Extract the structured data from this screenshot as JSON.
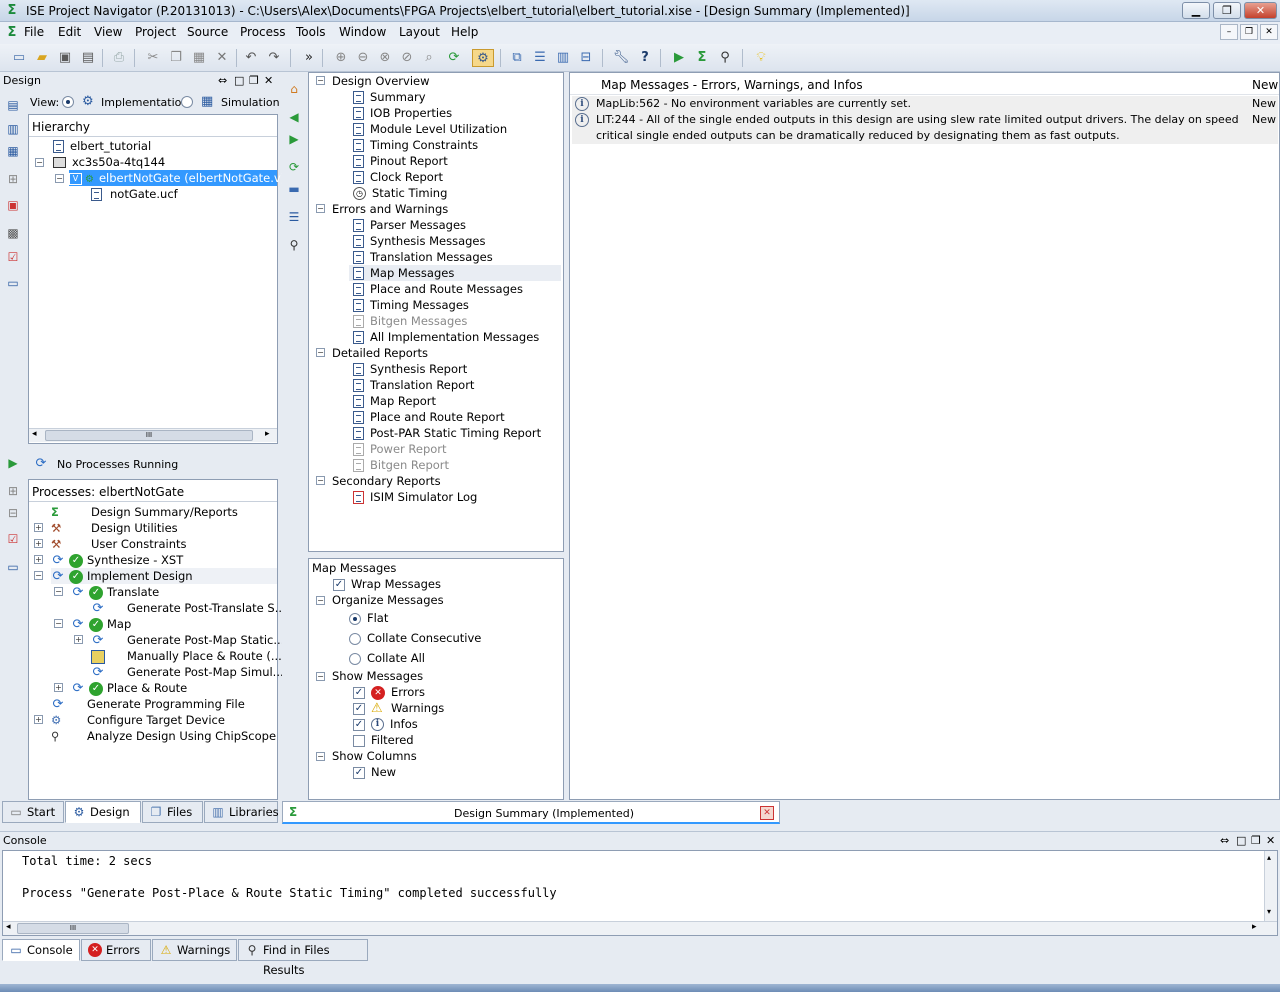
{
  "window": {
    "title": "ISE Project Navigator (P.20131013) - C:\\Users\\Alex\\Documents\\FPGA Projects\\elbert_tutorial\\elbert_tutorial.xise - [Design Summary (Implemented)]",
    "minimize": "▁",
    "restore": "❐",
    "close": "✕"
  },
  "menubar": {
    "items": [
      "File",
      "Edit",
      "View",
      "Project",
      "Source",
      "Process",
      "Tools",
      "Window",
      "Layout",
      "Help"
    ],
    "doc_min": "–",
    "doc_restore": "❐",
    "doc_close": "✕"
  },
  "design_panel": {
    "title": "Design",
    "view_label": "View:",
    "impl_label": "Implementation",
    "sim_label": "Simulation",
    "hierarchy_label": "Hierarchy",
    "tree": [
      {
        "label": "elbert_tutorial"
      },
      {
        "label": "xc3s50a-4tq144"
      },
      {
        "label": "elbertNotGate (elbertNotGate.v)"
      },
      {
        "label": "notGate.ucf"
      }
    ],
    "scroll_label": "III"
  },
  "process_panel": {
    "status": "No Processes Running",
    "header": "Processes: elbertNotGate",
    "items": [
      {
        "label": "Design Summary/Reports"
      },
      {
        "label": "Design Utilities"
      },
      {
        "label": "User Constraints"
      },
      {
        "label": "Synthesize - XST"
      },
      {
        "label": "Implement Design"
      },
      {
        "label": "Translate"
      },
      {
        "label": "Generate Post-Translate S..."
      },
      {
        "label": "Map"
      },
      {
        "label": "Generate Post-Map Static..."
      },
      {
        "label": "Manually Place & Route (..."
      },
      {
        "label": "Generate Post-Map Simul..."
      },
      {
        "label": "Place & Route"
      },
      {
        "label": "Generate Programming File"
      },
      {
        "label": "Configure Target Device"
      },
      {
        "label": "Analyze Design Using ChipScope"
      }
    ]
  },
  "left_tabs": [
    "Start",
    "Design",
    "Files",
    "Libraries"
  ],
  "summary_tree": {
    "sections": [
      {
        "title": "Design Overview",
        "items": [
          {
            "label": "Summary",
            "enabled": true
          },
          {
            "label": "IOB Properties",
            "enabled": true
          },
          {
            "label": "Module Level Utilization",
            "enabled": true
          },
          {
            "label": "Timing Constraints",
            "enabled": true
          },
          {
            "label": "Pinout Report",
            "enabled": true
          },
          {
            "label": "Clock Report",
            "enabled": true
          },
          {
            "label": "Static Timing",
            "enabled": true
          }
        ]
      },
      {
        "title": "Errors and Warnings",
        "items": [
          {
            "label": "Parser Messages",
            "enabled": true
          },
          {
            "label": "Synthesis Messages",
            "enabled": true
          },
          {
            "label": "Translation Messages",
            "enabled": true
          },
          {
            "label": "Map Messages",
            "enabled": true
          },
          {
            "label": "Place and Route Messages",
            "enabled": true
          },
          {
            "label": "Timing Messages",
            "enabled": true
          },
          {
            "label": "Bitgen Messages",
            "enabled": false
          },
          {
            "label": "All Implementation Messages",
            "enabled": true
          }
        ]
      },
      {
        "title": "Detailed Reports",
        "items": [
          {
            "label": "Synthesis Report",
            "enabled": true
          },
          {
            "label": "Translation Report",
            "enabled": true
          },
          {
            "label": "Map Report",
            "enabled": true
          },
          {
            "label": "Place and Route Report",
            "enabled": true
          },
          {
            "label": "Post-PAR Static Timing Report",
            "enabled": true
          },
          {
            "label": "Power Report",
            "enabled": false
          },
          {
            "label": "Bitgen Report",
            "enabled": false
          }
        ]
      },
      {
        "title": "Secondary Reports",
        "items": [
          {
            "label": "ISIM Simulator Log",
            "enabled": true
          }
        ]
      }
    ]
  },
  "options": {
    "title": "Map Messages",
    "wrap": "Wrap Messages",
    "organize": "Organize Messages",
    "flat": "Flat",
    "collate_consecutive": "Collate Consecutive",
    "collate_all": "Collate All",
    "show_messages": "Show Messages",
    "errors": "Errors",
    "warnings": "Warnings",
    "infos": "Infos",
    "filtered": "Filtered",
    "show_columns": "Show Columns",
    "new": "New"
  },
  "messages": {
    "header": "Map Messages - Errors, Warnings, and Infos",
    "new_col": "New",
    "rows": [
      {
        "text": "MapLib:562 - No environment variables are currently set.",
        "new": "New"
      },
      {
        "text": "LIT:244 - All of the single ended outputs in this design are using slew rate limited output drivers. The delay on speed critical single ended outputs can be dramatically reduced by designating them as fast outputs.",
        "new": "New"
      }
    ]
  },
  "doc_tab": {
    "label": "Design Summary (Implemented)"
  },
  "console": {
    "title": "Console",
    "lines": [
      "Total time: 2 secs",
      "",
      "Process \"Generate Post-Place & Route Static Timing\" completed successfully"
    ],
    "scroll_label": "III"
  },
  "bottom_tabs": [
    "Console",
    "Errors",
    "Warnings",
    "Find in Files Results"
  ]
}
